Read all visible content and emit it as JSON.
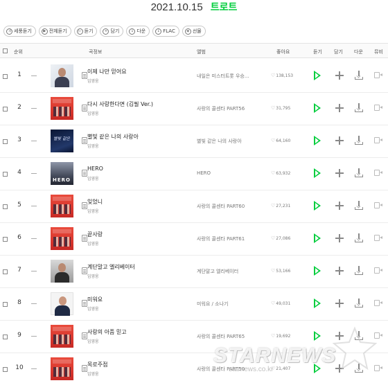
{
  "title": {
    "date": "2021.10.15",
    "genre": "트로트"
  },
  "toolbar": [
    {
      "label": "세풍듣기",
      "icon": "shuffle-icon"
    },
    {
      "label": "전체듣기",
      "icon": "play-all-icon"
    },
    {
      "label": "듣기",
      "icon": "play-icon"
    },
    {
      "label": "담기",
      "icon": "plus-icon"
    },
    {
      "label": "다운",
      "icon": "download-icon"
    },
    {
      "label": "FLAC",
      "icon": "flac-download-icon"
    },
    {
      "label": "선물",
      "icon": "gift-icon"
    }
  ],
  "header": {
    "rank": "순위",
    "song_info": "곡정보",
    "album": "앨범",
    "like": "좋아요",
    "listen": "듣기",
    "add": "담기",
    "download": "다운",
    "mv": "뮤비"
  },
  "rows": [
    {
      "rank": "1",
      "title": "이제 나만 믿어요",
      "artist": "임영웅",
      "album": "내일은 미스터트롯 우승...",
      "likes": "138,153",
      "art": "light"
    },
    {
      "rank": "2",
      "title": "다시 사랑한다면 (김필 Ver.)",
      "artist": "임영웅",
      "album": "사랑의 콜센타 PART56",
      "likes": "31,795",
      "art": "red"
    },
    {
      "rank": "3",
      "title": "별빛 같은 나의 사랑아",
      "artist": "임영웅",
      "album": "별빛 같은 나의 사랑아",
      "likes": "64,160",
      "art": "dark"
    },
    {
      "rank": "4",
      "title": "HERO",
      "artist": "임영웅",
      "album": "HERO",
      "likes": "63,932",
      "art": "hero"
    },
    {
      "rank": "5",
      "title": "잊었니",
      "artist": "임영웅",
      "album": "사랑의 콜센타 PART60",
      "likes": "27,231",
      "art": "red"
    },
    {
      "rank": "6",
      "title": "끝사랑",
      "artist": "임영웅",
      "album": "사랑의 콜센타 PART61",
      "likes": "27,086",
      "art": "red"
    },
    {
      "rank": "7",
      "title": "계단말고 엘리베이터",
      "artist": "임영웅",
      "album": "계단말고 엘리베이터",
      "likes": "53,166",
      "art": "gray"
    },
    {
      "rank": "8",
      "title": "미워요",
      "artist": "임영웅",
      "album": "미워요 / 소나기",
      "likes": "49,031",
      "art": "white"
    },
    {
      "rank": "9",
      "title": "사랑의 아픔 믿고",
      "artist": "임영웅",
      "album": "사랑의 콜센타 PART65",
      "likes": "19,692",
      "art": "red"
    },
    {
      "rank": "10",
      "title": "목로주점",
      "artist": "임영웅",
      "album": "사랑의 콜센타 PART50",
      "likes": "21,407",
      "art": "red"
    }
  ],
  "art_text": {
    "dark": "별빛 같은",
    "hero": "HERO"
  },
  "watermark": {
    "brand": "STARNEWS",
    "url": "starnews.co.kr"
  },
  "colors": {
    "accent": "#00cd3c"
  }
}
